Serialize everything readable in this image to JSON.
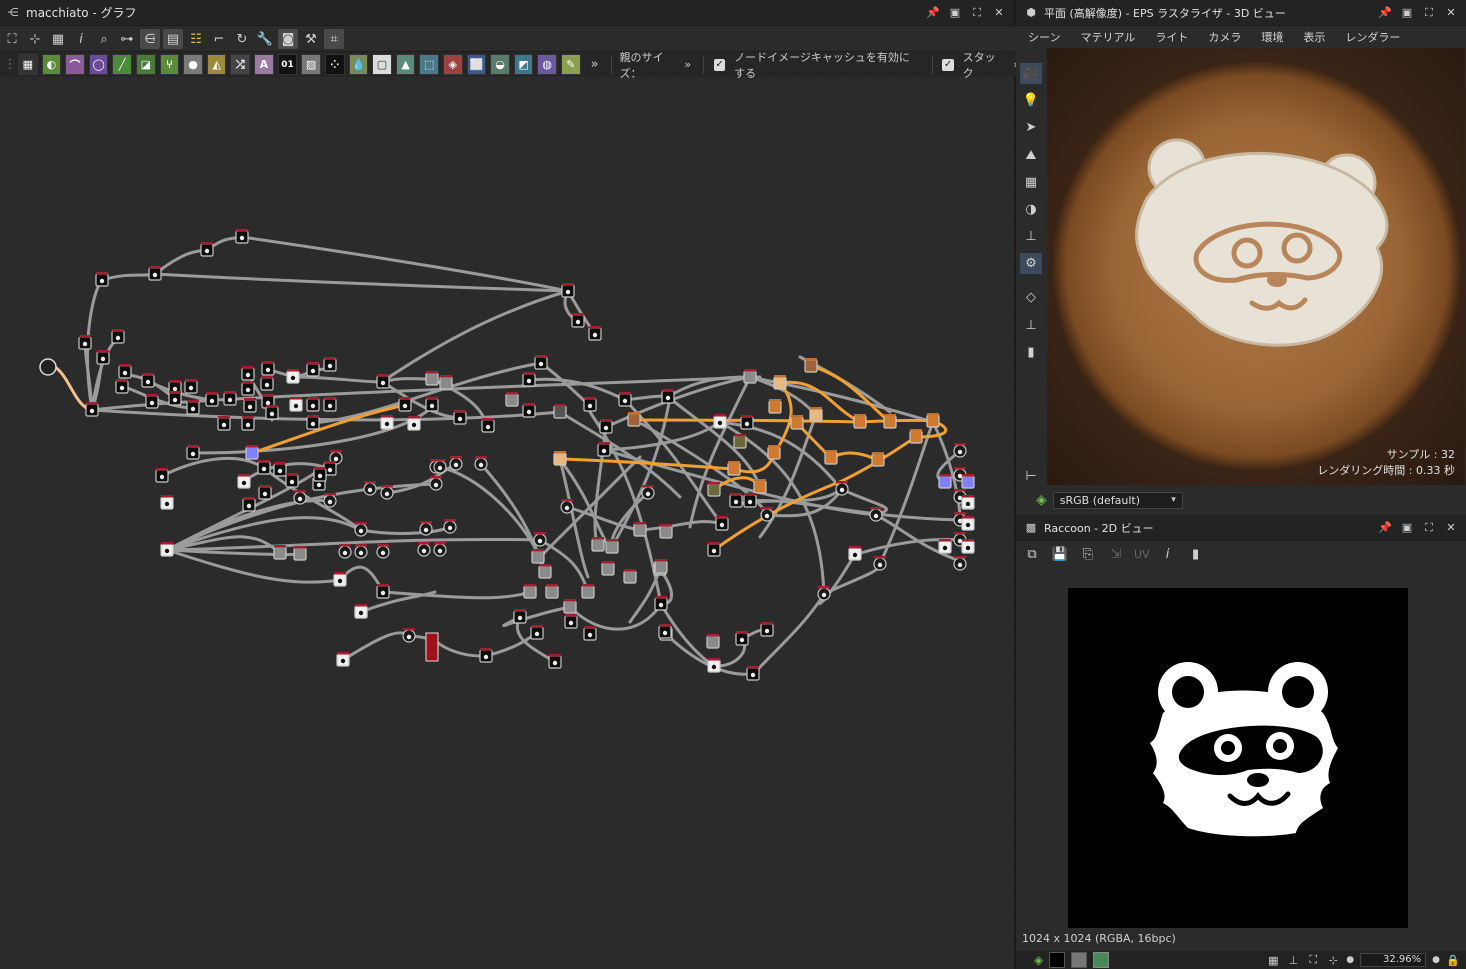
{
  "graph": {
    "title": "macchiato - グラフ",
    "toolbar2": {
      "overflow": "»",
      "parent_size": "親のサイズ：",
      "parent_size_arrow": "»",
      "node_cache_label": "ノードイメージキャッシュを有効にする",
      "stack_label": "スタック",
      "stack_arrow": "»"
    }
  },
  "view3d": {
    "title": "平面 (高解像度) - EPS ラスタライザ - 3D ビュー",
    "menu": [
      "シーン",
      "マテリアル",
      "ライト",
      "カメラ",
      "環境",
      "表示",
      "レンダラー"
    ],
    "samples": "サンプル : 32",
    "render_time": "レンダリング時間 : 0.33 秒",
    "colorspace": "sRGB (default)"
  },
  "view2d": {
    "title": "Raccoon - 2D ビュー",
    "uv_label": "UV",
    "status": "1024 x 1024 (RGBA, 16bpc)",
    "zoom": "32.96%"
  },
  "colors": {
    "panel_bg": "#2b2b2b",
    "header_bg": "#232323",
    "wire": "#9a9a9a",
    "wire_active": "#f0a030",
    "accent": "#3d6fb0"
  }
}
